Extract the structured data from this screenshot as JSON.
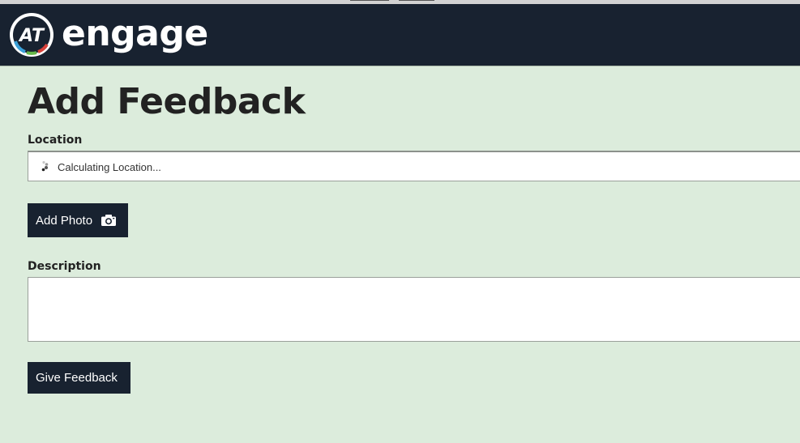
{
  "header": {
    "logo_text": "AT",
    "brand": "engage"
  },
  "main": {
    "title": "Add Feedback",
    "location": {
      "label": "Location",
      "status_text": "Calculating Location..."
    },
    "add_photo": {
      "label": "Add Photo",
      "icon": "camera-icon"
    },
    "description": {
      "label": "Description",
      "value": ""
    },
    "submit": {
      "label": "Give Feedback"
    }
  },
  "colors": {
    "header_bg": "#182230",
    "page_bg": "#dcecdc",
    "button_bg": "#182230"
  }
}
